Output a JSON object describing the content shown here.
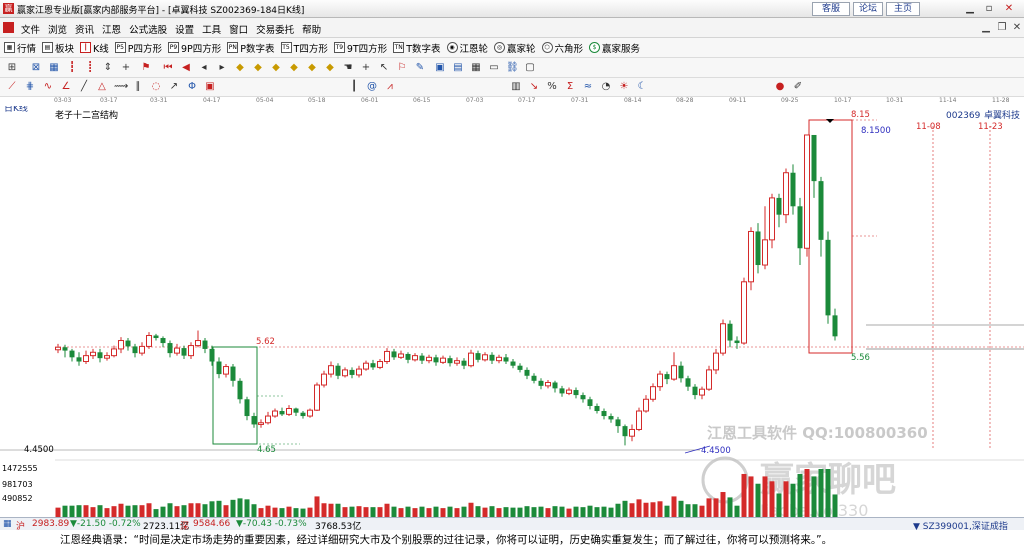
{
  "window": {
    "title": "赢家江恩专业版[赢家内部服务平台] - [卓翼科技 SZ002369-184日K线]",
    "buttons": [
      "客服",
      "论坛",
      "主页"
    ]
  },
  "menu": [
    "文件",
    "浏览",
    "资讯",
    "江恩",
    "公式选股",
    "设置",
    "工具",
    "窗口",
    "交易委托",
    "帮助"
  ],
  "toolbar": [
    {
      "icon": "grid-icon",
      "label": "行情"
    },
    {
      "icon": "blocks-icon",
      "label": "板块"
    },
    {
      "icon": "kline-icon",
      "label": "K线"
    },
    {
      "icon": "p-square-icon",
      "label": "P四方形",
      "tag": "P5"
    },
    {
      "icon": "9p-square-icon",
      "label": "9P四方形",
      "tag": "P9"
    },
    {
      "icon": "pn-table-icon",
      "label": "P数字表",
      "tag": "PN"
    },
    {
      "icon": "t-square-icon",
      "label": "T四方形",
      "tag": "T5"
    },
    {
      "icon": "9t-square-icon",
      "label": "9T四方形",
      "tag": "T9"
    },
    {
      "icon": "tn-table-icon",
      "label": "T数字表",
      "tag": "TN"
    },
    {
      "icon": "gann-wheel-icon",
      "label": "江恩轮"
    },
    {
      "icon": "winner-wheel-icon",
      "label": "赢家轮"
    },
    {
      "icon": "hexagon-icon",
      "label": "六角形"
    },
    {
      "icon": "dollar-icon",
      "label": "赢家服务"
    }
  ],
  "date_axis": [
    "03-03",
    "03-17",
    "03-31",
    "04-17",
    "05-04",
    "05-18",
    "06-01",
    "06-15",
    "07-03",
    "07-17",
    "07-31",
    "08-14",
    "08-28",
    "09-11",
    "09-25",
    "10-17",
    "10-31",
    "11-14",
    "11-28"
  ],
  "chart": {
    "period_label": "日K线",
    "study_label": "老子十二宫结构",
    "stock_code": "002369",
    "stock_name": "卓翼科技",
    "labels": {
      "high1": "8.15",
      "high2": "8.1500",
      "mid": "5.62",
      "low1": "4.65",
      "low2": "4.4500",
      "low3": "5.56",
      "axis_low": "4.4500"
    },
    "future_dates": [
      "11-08",
      "11-23"
    ],
    "vol_ticks": [
      "1472555",
      "981703",
      "490852"
    ],
    "watermark1": "江恩工具软件  QQ:100800360",
    "watermark2": "赢家聊吧",
    "watermark3": "Jiaoba.vo.330",
    "colors": {
      "up": "#d42a2a",
      "down": "#1b8a3a",
      "accent": "#2c2cbe"
    }
  },
  "chart_data": {
    "type": "candlestick",
    "title": "卓翼科技 002369",
    "ylim": [
      4.3,
      8.4
    ],
    "candles": [
      [
        5.59,
        5.62,
        5.66,
        5.55
      ],
      [
        5.62,
        5.58,
        5.65,
        5.5
      ],
      [
        5.58,
        5.5,
        5.6,
        5.45
      ],
      [
        5.5,
        5.45,
        5.56,
        5.4
      ],
      [
        5.45,
        5.52,
        5.58,
        5.42
      ],
      [
        5.52,
        5.56,
        5.6,
        5.48
      ],
      [
        5.56,
        5.49,
        5.6,
        5.44
      ],
      [
        5.49,
        5.52,
        5.56,
        5.46
      ],
      [
        5.52,
        5.6,
        5.64,
        5.5
      ],
      [
        5.6,
        5.7,
        5.74,
        5.55
      ],
      [
        5.7,
        5.63,
        5.73,
        5.58
      ],
      [
        5.63,
        5.55,
        5.66,
        5.5
      ],
      [
        5.55,
        5.63,
        5.68,
        5.52
      ],
      [
        5.63,
        5.76,
        5.8,
        5.6
      ],
      [
        5.76,
        5.73,
        5.78,
        5.7
      ],
      [
        5.73,
        5.67,
        5.75,
        5.62
      ],
      [
        5.67,
        5.55,
        5.7,
        5.5
      ],
      [
        5.55,
        5.61,
        5.66,
        5.52
      ],
      [
        5.61,
        5.52,
        5.64,
        5.48
      ],
      [
        5.52,
        5.64,
        5.68,
        5.48
      ],
      [
        5.64,
        5.7,
        5.82,
        5.62
      ],
      [
        5.7,
        5.6,
        5.73,
        5.55
      ],
      [
        5.6,
        5.45,
        5.64,
        5.4
      ],
      [
        5.45,
        5.3,
        5.5,
        5.25
      ],
      [
        5.3,
        5.39,
        5.42,
        5.26
      ],
      [
        5.39,
        5.22,
        5.42,
        5.15
      ],
      [
        5.22,
        5.0,
        5.25,
        4.95
      ],
      [
        5.0,
        4.8,
        5.03,
        4.75
      ],
      [
        4.8,
        4.7,
        4.84,
        4.66
      ],
      [
        4.7,
        4.72,
        4.76,
        4.66
      ],
      [
        4.72,
        4.8,
        4.85,
        4.7
      ],
      [
        4.8,
        4.86,
        4.89,
        4.78
      ],
      [
        4.86,
        4.82,
        4.9,
        4.8
      ],
      [
        4.82,
        4.89,
        4.93,
        4.8
      ],
      [
        4.89,
        4.84,
        4.9,
        4.8
      ],
      [
        4.84,
        4.8,
        4.86,
        4.77
      ],
      [
        4.8,
        4.87,
        4.89,
        4.78
      ],
      [
        4.87,
        5.17,
        5.2,
        4.86
      ],
      [
        5.17,
        5.3,
        5.34,
        5.14
      ],
      [
        5.3,
        5.4,
        5.45,
        5.26
      ],
      [
        5.4,
        5.28,
        5.43,
        5.24
      ],
      [
        5.28,
        5.35,
        5.38,
        5.26
      ],
      [
        5.35,
        5.29,
        5.38,
        5.25
      ],
      [
        5.29,
        5.36,
        5.4,
        5.26
      ],
      [
        5.36,
        5.43,
        5.46,
        5.34
      ],
      [
        5.43,
        5.38,
        5.47,
        5.35
      ],
      [
        5.38,
        5.45,
        5.48,
        5.36
      ],
      [
        5.45,
        5.57,
        5.61,
        5.42
      ],
      [
        5.57,
        5.5,
        5.6,
        5.47
      ],
      [
        5.5,
        5.54,
        5.58,
        5.48
      ],
      [
        5.54,
        5.47,
        5.56,
        5.43
      ],
      [
        5.47,
        5.52,
        5.55,
        5.45
      ],
      [
        5.52,
        5.46,
        5.55,
        5.42
      ],
      [
        5.46,
        5.5,
        5.53,
        5.43
      ],
      [
        5.5,
        5.44,
        5.53,
        5.4
      ],
      [
        5.44,
        5.49,
        5.52,
        5.42
      ],
      [
        5.49,
        5.43,
        5.52,
        5.39
      ],
      [
        5.43,
        5.46,
        5.5,
        5.4
      ],
      [
        5.46,
        5.4,
        5.49,
        5.36
      ],
      [
        5.4,
        5.55,
        5.59,
        5.38
      ],
      [
        5.55,
        5.47,
        5.58,
        5.44
      ],
      [
        5.47,
        5.53,
        5.56,
        5.45
      ],
      [
        5.53,
        5.46,
        5.56,
        5.42
      ],
      [
        5.46,
        5.5,
        5.53,
        5.43
      ],
      [
        5.5,
        5.45,
        5.54,
        5.42
      ],
      [
        5.45,
        5.4,
        5.48,
        5.37
      ],
      [
        5.4,
        5.35,
        5.43,
        5.32
      ],
      [
        5.35,
        5.28,
        5.38,
        5.24
      ],
      [
        5.28,
        5.22,
        5.31,
        5.19
      ],
      [
        5.22,
        5.16,
        5.25,
        5.12
      ],
      [
        5.16,
        5.2,
        5.23,
        5.13
      ],
      [
        5.2,
        5.13,
        5.22,
        5.08
      ],
      [
        5.13,
        5.07,
        5.16,
        5.03
      ],
      [
        5.07,
        5.11,
        5.14,
        5.05
      ],
      [
        5.11,
        5.05,
        5.14,
        5.01
      ],
      [
        5.05,
        5.0,
        5.08,
        4.96
      ],
      [
        5.0,
        4.92,
        5.03,
        4.88
      ],
      [
        4.92,
        4.86,
        4.95,
        4.83
      ],
      [
        4.86,
        4.8,
        4.89,
        4.76
      ],
      [
        4.8,
        4.76,
        4.83,
        4.72
      ],
      [
        4.76,
        4.68,
        4.79,
        4.6
      ],
      [
        4.68,
        4.56,
        4.7,
        4.45
      ],
      [
        4.56,
        4.64,
        4.7,
        4.5
      ],
      [
        4.64,
        4.86,
        4.9,
        4.62
      ],
      [
        4.86,
        5.0,
        5.05,
        4.84
      ],
      [
        5.0,
        5.15,
        5.19,
        4.97
      ],
      [
        5.15,
        5.3,
        5.34,
        5.1
      ],
      [
        5.3,
        5.24,
        5.33,
        5.18
      ],
      [
        5.24,
        5.4,
        5.56,
        5.22
      ],
      [
        5.4,
        5.25,
        5.45,
        5.2
      ],
      [
        5.25,
        5.15,
        5.28,
        5.1
      ],
      [
        5.15,
        5.05,
        5.18,
        5.0
      ],
      [
        5.05,
        5.12,
        5.15,
        5.0
      ],
      [
        5.12,
        5.35,
        5.4,
        5.1
      ],
      [
        5.35,
        5.55,
        5.6,
        5.3
      ],
      [
        5.55,
        5.9,
        5.95,
        5.52
      ],
      [
        5.9,
        5.7,
        5.94,
        5.62
      ],
      [
        5.7,
        5.67,
        5.75,
        5.6
      ],
      [
        5.67,
        6.4,
        6.45,
        5.65
      ],
      [
        6.4,
        7.0,
        7.05,
        6.3
      ],
      [
        7.0,
        6.6,
        7.1,
        6.5
      ],
      [
        6.6,
        6.9,
        7.3,
        6.55
      ],
      [
        6.9,
        7.4,
        7.45,
        6.8
      ],
      [
        7.4,
        7.2,
        7.45,
        7.05
      ],
      [
        7.2,
        7.7,
        7.75,
        7.1
      ],
      [
        7.7,
        7.3,
        7.8,
        7.2
      ],
      [
        7.3,
        6.8,
        7.4,
        6.6
      ],
      [
        6.8,
        8.15,
        8.15,
        6.7
      ],
      [
        8.15,
        7.6,
        8.15,
        7.4
      ],
      [
        7.6,
        6.9,
        7.65,
        6.7
      ],
      [
        6.9,
        6.0,
        7.0,
        5.9
      ],
      [
        6.0,
        5.75,
        6.08,
        5.7
      ]
    ]
  }
}
